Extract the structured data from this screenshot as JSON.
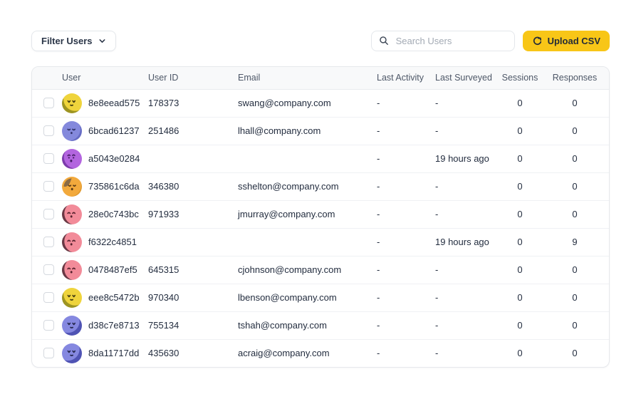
{
  "toolbar": {
    "filter_label": "Filter Users",
    "search_placeholder": "Search Users",
    "upload_label": "Upload CSV"
  },
  "colors": {
    "accent_yellow": "#F8C617",
    "text_primary": "#232D3F",
    "text_header": "#4D5767",
    "border": "#E6E8EC",
    "header_bg": "#F8F9FA"
  },
  "table": {
    "columns": [
      "User",
      "User ID",
      "Email",
      "Last Activity",
      "Last Surveyed",
      "Sessions",
      "Responses"
    ],
    "rows": [
      {
        "user": "8e8eead575",
        "user_id": "178373",
        "email": "swang@company.com",
        "last_activity": "-",
        "last_surveyed": "-",
        "sessions": "0",
        "responses": "0",
        "avatar": {
          "bg": "#EFD43C",
          "shade": "#9D9422",
          "grad": "66% 30%",
          "face": "vv",
          "ink": "#453E12"
        }
      },
      {
        "user": "6bcad61237",
        "user_id": "251486",
        "email": "lhall@company.com",
        "last_activity": "-",
        "last_surveyed": "-",
        "sessions": "0",
        "responses": "0",
        "avatar": {
          "bg": "#8489DC",
          "shade": "#666CC4",
          "grad": "34% 40%",
          "face": "sleep",
          "ink": "#2F3166"
        }
      },
      {
        "user": "a5043e0284",
        "user_id": "",
        "email": "",
        "last_activity": "-",
        "last_surveyed": "19 hours ago",
        "sessions": "0",
        "responses": "0",
        "avatar": {
          "bg": "#B365DF",
          "shade": "#7C3BAB",
          "grad": "68% 40%",
          "face": "surprise",
          "ink": "#471F66"
        }
      },
      {
        "user": "735861c6da",
        "user_id": "346380",
        "email": "sshelton@company.com",
        "last_activity": "-",
        "last_surveyed": "-",
        "sessions": "0",
        "responses": "0",
        "avatar": {
          "bg": "#F2A93C",
          "shade": "#E09A2F",
          "grad": "38% 42%",
          "face": "hair",
          "ink": "#5C3A14",
          "hair": "#8A6A45"
        }
      },
      {
        "user": "28e0c743bc",
        "user_id": "971933",
        "email": "jmurray@company.com",
        "last_activity": "-",
        "last_surveyed": "-",
        "sessions": "0",
        "responses": "0",
        "avatar": {
          "bg": "#F28B99",
          "shade": "#693844",
          "grad": "70% 45%",
          "face": "happy",
          "ink": "#55212D"
        }
      },
      {
        "user": "f6322c4851",
        "user_id": "",
        "email": "",
        "last_activity": "-",
        "last_surveyed": "19 hours ago",
        "sessions": "0",
        "responses": "9",
        "avatar": {
          "bg": "#F28B99",
          "shade": "#693844",
          "grad": "70% 45%",
          "face": "happy",
          "ink": "#55212D"
        }
      },
      {
        "user": "0478487ef5",
        "user_id": "645315",
        "email": "cjohnson@company.com",
        "last_activity": "-",
        "last_surveyed": "-",
        "sessions": "0",
        "responses": "0",
        "avatar": {
          "bg": "#F28B99",
          "shade": "#693844",
          "grad": "70% 45%",
          "face": "happy",
          "ink": "#55212D"
        }
      },
      {
        "user": "eee8c5472b",
        "user_id": "970340",
        "email": "lbenson@company.com",
        "last_activity": "-",
        "last_surveyed": "-",
        "sessions": "0",
        "responses": "0",
        "avatar": {
          "bg": "#EFD43C",
          "shade": "#9D9422",
          "grad": "66% 30%",
          "face": "vv",
          "ink": "#453E12"
        }
      },
      {
        "user": "d38c7e8713",
        "user_id": "755134",
        "email": "tshah@company.com",
        "last_activity": "-",
        "last_surveyed": "-",
        "sessions": "0",
        "responses": "0",
        "avatar": {
          "bg": "#8588E0",
          "shade": "#4F53B4",
          "grad": "30% 28%",
          "face": "vv",
          "ink": "#26284F"
        }
      },
      {
        "user": "8da11717dd",
        "user_id": "435630",
        "email": "acraig@company.com",
        "last_activity": "-",
        "last_surveyed": "-",
        "sessions": "0",
        "responses": "0",
        "avatar": {
          "bg": "#8588E0",
          "shade": "#4F53B4",
          "grad": "30% 28%",
          "face": "vv",
          "ink": "#26284F"
        }
      }
    ]
  }
}
